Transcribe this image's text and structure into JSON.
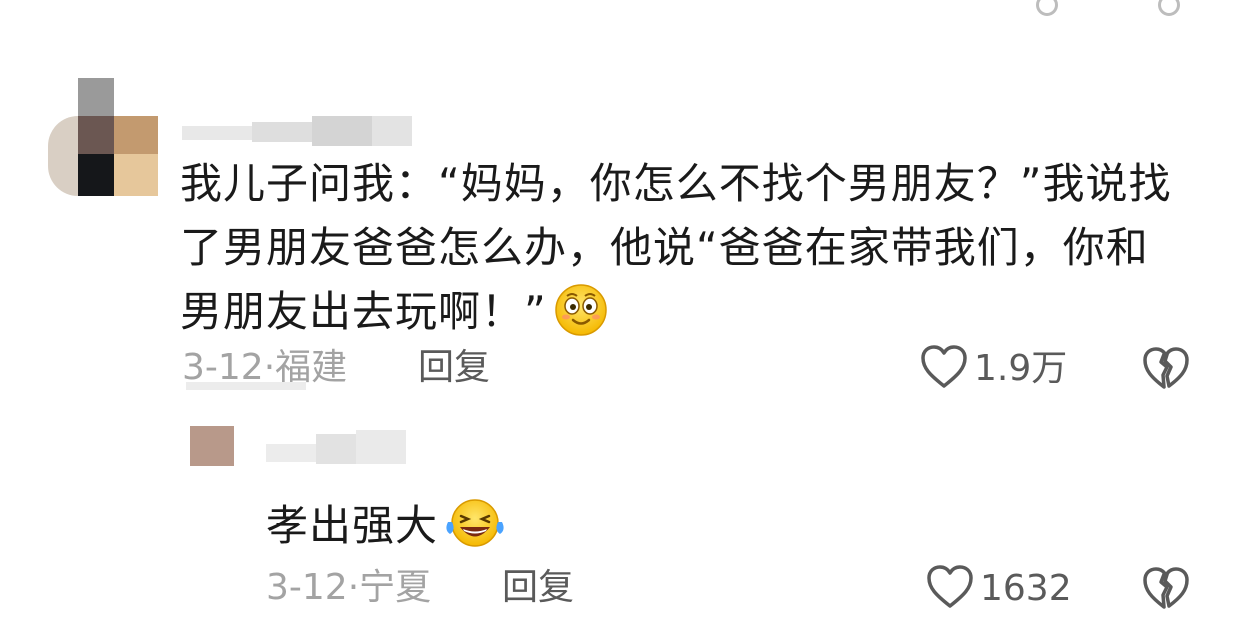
{
  "comment": {
    "text": "我儿子问我：“妈妈，你怎么不找个男朋友？”我说找了男朋友爸爸怎么办，他说“爸爸在家带我们，你和男朋友出去玩啊！”",
    "date": "3-12·",
    "location": "福建",
    "reply_label": "回复",
    "likes": "1.9万"
  },
  "reply": {
    "text": "孝出强大",
    "date": "3-12·",
    "location": "宁夏",
    "reply_label": "回复",
    "likes": "1632"
  },
  "icons": {
    "like": "heart-outline-icon",
    "dislike": "broken-heart-icon",
    "emoji_comment": "smiling-face-icon",
    "emoji_reply": "laughing-tears-icon"
  }
}
